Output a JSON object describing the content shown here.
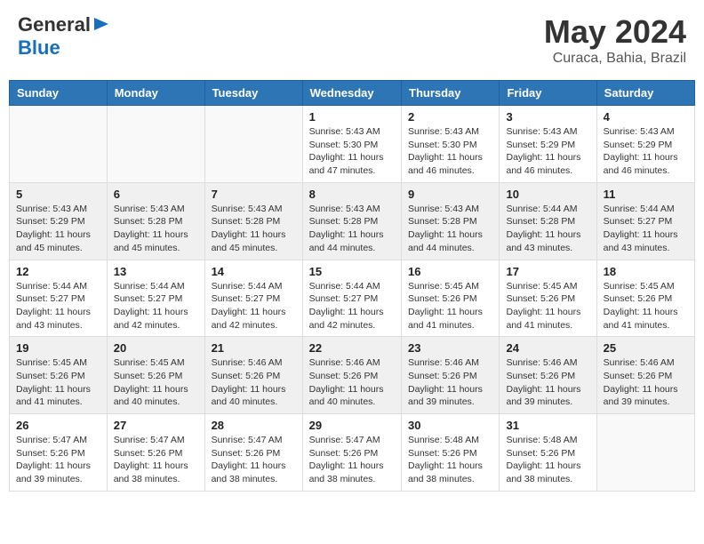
{
  "header": {
    "logo_general": "General",
    "logo_blue": "Blue",
    "title": "May 2024",
    "subtitle": "Curaca, Bahia, Brazil"
  },
  "calendar": {
    "days_of_week": [
      "Sunday",
      "Monday",
      "Tuesday",
      "Wednesday",
      "Thursday",
      "Friday",
      "Saturday"
    ],
    "weeks": [
      [
        {
          "day": "",
          "info": ""
        },
        {
          "day": "",
          "info": ""
        },
        {
          "day": "",
          "info": ""
        },
        {
          "day": "1",
          "info": "Sunrise: 5:43 AM\nSunset: 5:30 PM\nDaylight: 11 hours and 47 minutes."
        },
        {
          "day": "2",
          "info": "Sunrise: 5:43 AM\nSunset: 5:30 PM\nDaylight: 11 hours and 46 minutes."
        },
        {
          "day": "3",
          "info": "Sunrise: 5:43 AM\nSunset: 5:29 PM\nDaylight: 11 hours and 46 minutes."
        },
        {
          "day": "4",
          "info": "Sunrise: 5:43 AM\nSunset: 5:29 PM\nDaylight: 11 hours and 46 minutes."
        }
      ],
      [
        {
          "day": "5",
          "info": "Sunrise: 5:43 AM\nSunset: 5:29 PM\nDaylight: 11 hours and 45 minutes."
        },
        {
          "day": "6",
          "info": "Sunrise: 5:43 AM\nSunset: 5:28 PM\nDaylight: 11 hours and 45 minutes."
        },
        {
          "day": "7",
          "info": "Sunrise: 5:43 AM\nSunset: 5:28 PM\nDaylight: 11 hours and 45 minutes."
        },
        {
          "day": "8",
          "info": "Sunrise: 5:43 AM\nSunset: 5:28 PM\nDaylight: 11 hours and 44 minutes."
        },
        {
          "day": "9",
          "info": "Sunrise: 5:43 AM\nSunset: 5:28 PM\nDaylight: 11 hours and 44 minutes."
        },
        {
          "day": "10",
          "info": "Sunrise: 5:44 AM\nSunset: 5:28 PM\nDaylight: 11 hours and 43 minutes."
        },
        {
          "day": "11",
          "info": "Sunrise: 5:44 AM\nSunset: 5:27 PM\nDaylight: 11 hours and 43 minutes."
        }
      ],
      [
        {
          "day": "12",
          "info": "Sunrise: 5:44 AM\nSunset: 5:27 PM\nDaylight: 11 hours and 43 minutes."
        },
        {
          "day": "13",
          "info": "Sunrise: 5:44 AM\nSunset: 5:27 PM\nDaylight: 11 hours and 42 minutes."
        },
        {
          "day": "14",
          "info": "Sunrise: 5:44 AM\nSunset: 5:27 PM\nDaylight: 11 hours and 42 minutes."
        },
        {
          "day": "15",
          "info": "Sunrise: 5:44 AM\nSunset: 5:27 PM\nDaylight: 11 hours and 42 minutes."
        },
        {
          "day": "16",
          "info": "Sunrise: 5:45 AM\nSunset: 5:26 PM\nDaylight: 11 hours and 41 minutes."
        },
        {
          "day": "17",
          "info": "Sunrise: 5:45 AM\nSunset: 5:26 PM\nDaylight: 11 hours and 41 minutes."
        },
        {
          "day": "18",
          "info": "Sunrise: 5:45 AM\nSunset: 5:26 PM\nDaylight: 11 hours and 41 minutes."
        }
      ],
      [
        {
          "day": "19",
          "info": "Sunrise: 5:45 AM\nSunset: 5:26 PM\nDaylight: 11 hours and 41 minutes."
        },
        {
          "day": "20",
          "info": "Sunrise: 5:45 AM\nSunset: 5:26 PM\nDaylight: 11 hours and 40 minutes."
        },
        {
          "day": "21",
          "info": "Sunrise: 5:46 AM\nSunset: 5:26 PM\nDaylight: 11 hours and 40 minutes."
        },
        {
          "day": "22",
          "info": "Sunrise: 5:46 AM\nSunset: 5:26 PM\nDaylight: 11 hours and 40 minutes."
        },
        {
          "day": "23",
          "info": "Sunrise: 5:46 AM\nSunset: 5:26 PM\nDaylight: 11 hours and 39 minutes."
        },
        {
          "day": "24",
          "info": "Sunrise: 5:46 AM\nSunset: 5:26 PM\nDaylight: 11 hours and 39 minutes."
        },
        {
          "day": "25",
          "info": "Sunrise: 5:46 AM\nSunset: 5:26 PM\nDaylight: 11 hours and 39 minutes."
        }
      ],
      [
        {
          "day": "26",
          "info": "Sunrise: 5:47 AM\nSunset: 5:26 PM\nDaylight: 11 hours and 39 minutes."
        },
        {
          "day": "27",
          "info": "Sunrise: 5:47 AM\nSunset: 5:26 PM\nDaylight: 11 hours and 38 minutes."
        },
        {
          "day": "28",
          "info": "Sunrise: 5:47 AM\nSunset: 5:26 PM\nDaylight: 11 hours and 38 minutes."
        },
        {
          "day": "29",
          "info": "Sunrise: 5:47 AM\nSunset: 5:26 PM\nDaylight: 11 hours and 38 minutes."
        },
        {
          "day": "30",
          "info": "Sunrise: 5:48 AM\nSunset: 5:26 PM\nDaylight: 11 hours and 38 minutes."
        },
        {
          "day": "31",
          "info": "Sunrise: 5:48 AM\nSunset: 5:26 PM\nDaylight: 11 hours and 38 minutes."
        },
        {
          "day": "",
          "info": ""
        }
      ]
    ]
  }
}
